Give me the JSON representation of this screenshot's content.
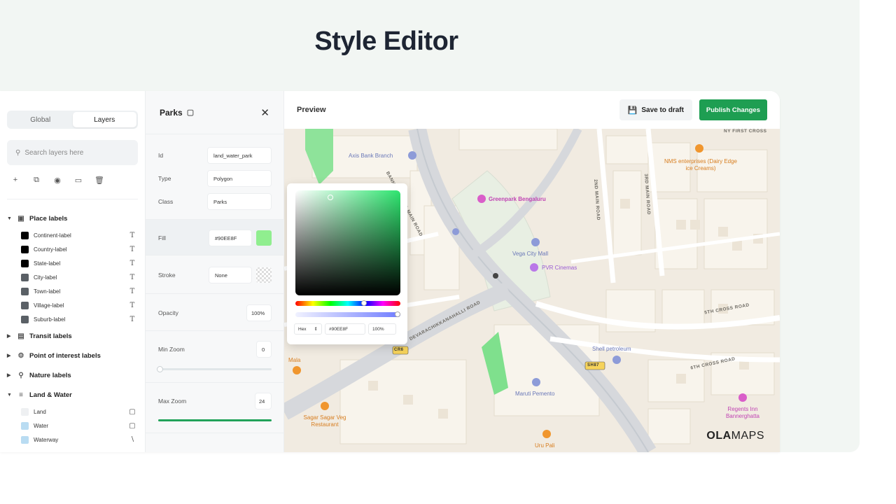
{
  "page": {
    "title": "Style Editor"
  },
  "layers_panel": {
    "tabs": [
      {
        "label": "Global",
        "active": false
      },
      {
        "label": "Layers",
        "active": true
      }
    ],
    "search": {
      "placeholder": "Search layers here"
    },
    "toolbar_icons": [
      "add-icon",
      "duplicate-icon",
      "hide-icon",
      "folder-icon",
      "trash-icon"
    ],
    "groups": [
      {
        "label": "Place labels",
        "expanded": true,
        "icon": "place-label-icon",
        "items": [
          {
            "label": "Continent-label",
            "color": "#000000"
          },
          {
            "label": "Country-label",
            "color": "#000000"
          },
          {
            "label": "State-label",
            "color": "#000000"
          },
          {
            "label": "City-label",
            "color": "#5a6066"
          },
          {
            "label": "Town-label",
            "color": "#5a6066"
          },
          {
            "label": "Village-label",
            "color": "#5a6066"
          },
          {
            "label": "Suburb-label",
            "color": "#5a6066"
          }
        ]
      },
      {
        "label": "Transit labels",
        "expanded": false,
        "icon": "transit-icon"
      },
      {
        "label": "Point of interest labels",
        "expanded": false,
        "icon": "gear-icon"
      },
      {
        "label": "Nature labels",
        "expanded": false,
        "icon": "nature-icon"
      },
      {
        "label": "Land & Water",
        "expanded": true,
        "icon": "layers-icon",
        "items": [
          {
            "label": "Land",
            "color": "#eef0f2"
          },
          {
            "label": "Water",
            "color": "#b9dcf2"
          },
          {
            "label": "Waterway",
            "color": "#b9dcf2"
          }
        ]
      }
    ]
  },
  "properties": {
    "title": "Parks",
    "id": {
      "label": "Id",
      "value": "land_water_park"
    },
    "type": {
      "label": "Type",
      "value": "Polygon"
    },
    "class": {
      "label": "Class",
      "value": "Parks"
    },
    "fill": {
      "label": "Fill",
      "value": "#90EE8F",
      "color": "#90ee8f"
    },
    "stroke": {
      "label": "Stroke",
      "value": "None"
    },
    "opacity": {
      "label": "Opacity",
      "value": "100%"
    },
    "min_zoom": {
      "label": "Min Zoom",
      "value": "0",
      "level": 0
    },
    "max_zoom": {
      "label": "Max Zoom",
      "value": "24",
      "level": 1
    }
  },
  "preview": {
    "title": "Preview",
    "save_label": "Save to draft",
    "publish_label": "Publish Changes",
    "picker": {
      "mode": "Hex",
      "hex": "#90EE8F",
      "alpha": "100%"
    },
    "pois": [
      {
        "name": "Axis Bank Branch"
      },
      {
        "name": "Greenpark Bengaluru"
      },
      {
        "name": "NMS enterprises (Dairy Edge ice Creams)"
      },
      {
        "name": "Vega City Mall"
      },
      {
        "name": "PVR Cinemas"
      },
      {
        "name": "Shell petroleum"
      },
      {
        "name": "Maruti Pemento"
      },
      {
        "name": "Regents Inn Bannerghatta"
      },
      {
        "name": "Sagar Sagar Veg Restaurant"
      },
      {
        "name": "Uru Pali"
      },
      {
        "name": "Mala"
      }
    ],
    "roads": [
      "BANNERGHATTA MAIN ROAD",
      "2ND MAIN ROAD",
      "3RD MAIN ROAD",
      "5TH CROSS ROAD",
      "6TH CROSS ROAD",
      "DEVARACHIKKANAHALLI ROAD",
      "NY FIRST CROSS"
    ],
    "shields": [
      "CR6",
      "SH87"
    ],
    "logo": {
      "bold": "OLA",
      "light": "MAPS"
    }
  }
}
